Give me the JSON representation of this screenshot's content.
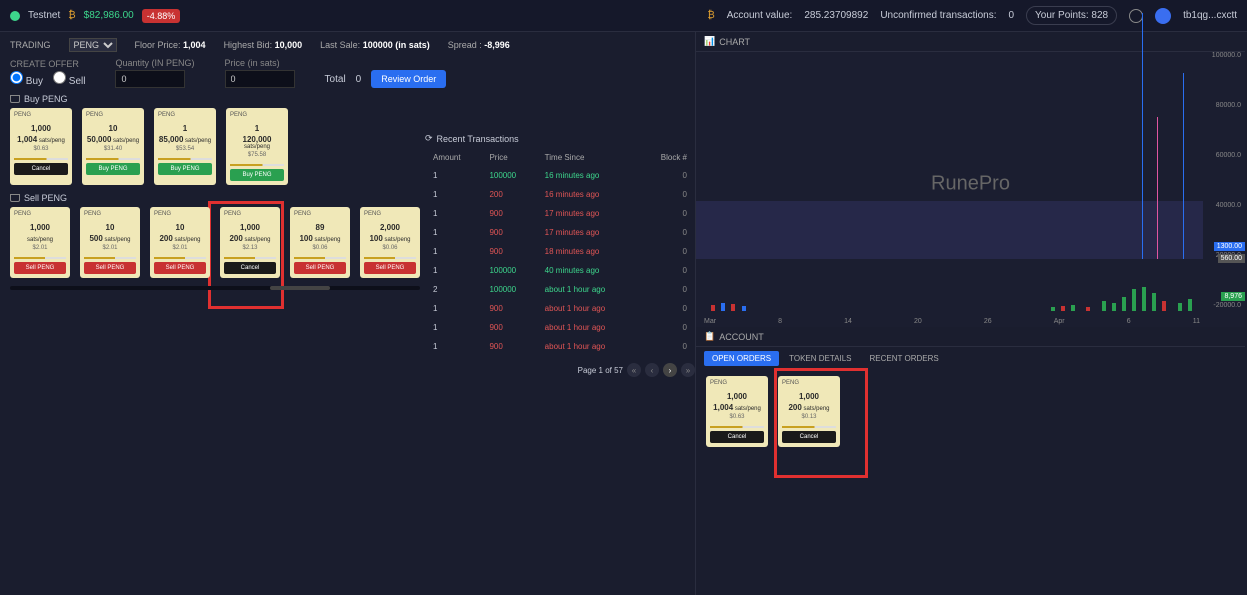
{
  "topbar": {
    "network": "Testnet",
    "balance_btc": "$82,986.00",
    "change_pct": "-4.88%",
    "account_value_label": "Account value:",
    "account_value": "285.23709892",
    "unconfirmed_label": "Unconfirmed transactions:",
    "unconfirmed": "0",
    "points_label": "Your Points:",
    "points": "828",
    "wallet": "tb1qg...cxctt"
  },
  "stats": {
    "trading_label": "TRADING",
    "token": "PENG",
    "floor_label": "Floor Price:",
    "floor": "1,004",
    "highbid_label": "Highest Bid:",
    "highbid": "10,000",
    "lastsale_label": "Last Sale:",
    "lastsale": "100000 (in sats)",
    "spread_label": "Spread :",
    "spread": "-8,996"
  },
  "offer": {
    "create_label": "CREATE OFFER",
    "qty_label": "Quantity",
    "qty_unit": "(IN PENG)",
    "price_label": "Price",
    "price_unit": "(in sats)",
    "buy": "Buy",
    "sell": "Sell",
    "qty_val": "0",
    "price_val": "0",
    "total_label": "Total",
    "total_val": "0",
    "review": "Review Order"
  },
  "buy_section": {
    "title": "Buy PENG"
  },
  "sell_section": {
    "title": "Sell PENG"
  },
  "buy_cards": [
    {
      "tkr": "PENG",
      "amt": "1,000",
      "rate": "1,004",
      "unit": "sats/peng",
      "usd": "$0.63",
      "btn": "Cancel",
      "cls": "btn-black"
    },
    {
      "tkr": "PENG",
      "amt": "10",
      "rate": "50,000",
      "unit": "sats/peng",
      "usd": "$31.40",
      "btn": "Buy PENG",
      "cls": "btn-green"
    },
    {
      "tkr": "PENG",
      "amt": "1",
      "rate": "85,000",
      "unit": "sats/peng",
      "usd": "$53.54",
      "btn": "Buy PENG",
      "cls": "btn-green"
    },
    {
      "tkr": "PENG",
      "amt": "1",
      "rate": "120,000",
      "unit": "sats/peng",
      "usd": "$75.58",
      "btn": "Buy PENG",
      "cls": "btn-green"
    }
  ],
  "sell_cards": [
    {
      "tkr": "PENG",
      "amt": "1,000",
      "rate": "",
      "unit": "sats/peng",
      "usd": "$2.01",
      "btn": "Sell PENG",
      "cls": "btn-red"
    },
    {
      "tkr": "PENG",
      "amt": "10",
      "rate": "500",
      "unit": "sats/peng",
      "usd": "$2.01",
      "btn": "Sell PENG",
      "cls": "btn-red"
    },
    {
      "tkr": "PENG",
      "amt": "10",
      "rate": "200",
      "unit": "sats/peng",
      "usd": "$2.01",
      "btn": "Sell PENG",
      "cls": "btn-red"
    },
    {
      "tkr": "PENG",
      "amt": "1,000",
      "rate": "200",
      "unit": "sats/peng",
      "usd": "$2.13",
      "btn": "Cancel",
      "cls": "btn-black"
    },
    {
      "tkr": "PENG",
      "amt": "89",
      "rate": "100",
      "unit": "sats/peng",
      "usd": "$0.06",
      "btn": "Sell PENG",
      "cls": "btn-red"
    },
    {
      "tkr": "PENG",
      "amt": "2,000",
      "rate": "100",
      "unit": "sats/peng",
      "usd": "$0.06",
      "btn": "Sell PENG",
      "cls": "btn-red"
    }
  ],
  "tx": {
    "title": "Recent Transactions",
    "cols": {
      "amount": "Amount",
      "price": "Price",
      "time": "Time Since",
      "block": "Block #"
    },
    "rows": [
      {
        "side": "buy",
        "a": "1",
        "p": "100000",
        "t": "16 minutes ago",
        "b": "0"
      },
      {
        "side": "sell",
        "a": "1",
        "p": "200",
        "t": "16 minutes ago",
        "b": "0"
      },
      {
        "side": "sell",
        "a": "1",
        "p": "900",
        "t": "17 minutes ago",
        "b": "0"
      },
      {
        "side": "sell",
        "a": "1",
        "p": "900",
        "t": "17 minutes ago",
        "b": "0"
      },
      {
        "side": "sell",
        "a": "1",
        "p": "900",
        "t": "18 minutes ago",
        "b": "0"
      },
      {
        "side": "buy",
        "a": "1",
        "p": "100000",
        "t": "40 minutes ago",
        "b": "0"
      },
      {
        "side": "buy",
        "a": "2",
        "p": "100000",
        "t": "about 1 hour ago",
        "b": "0"
      },
      {
        "side": "sell",
        "a": "1",
        "p": "900",
        "t": "about 1 hour ago",
        "b": "0"
      },
      {
        "side": "sell",
        "a": "1",
        "p": "900",
        "t": "about 1 hour ago",
        "b": "0"
      },
      {
        "side": "sell",
        "a": "1",
        "p": "900",
        "t": "about 1 hour ago",
        "b": "0"
      }
    ],
    "page_label": "Page 1 of 57"
  },
  "chart": {
    "title": "CHART",
    "watermark": "RunePro",
    "price_tag_blue": "1300.00",
    "price_tag_gray": "560.00",
    "price_tag_green": "8,976"
  },
  "chart_data": {
    "type": "bar",
    "ylabel": "",
    "ylim": [
      0,
      100000
    ],
    "y_ticks": [
      100000,
      80000,
      60000,
      40000,
      20000,
      -20000
    ],
    "x_ticks": [
      "Mar",
      "8",
      "14",
      "20",
      "26",
      "Apr",
      "6",
      "11"
    ],
    "volume_bars": [
      {
        "x_pct": 3,
        "h": 6,
        "color": "#c83232"
      },
      {
        "x_pct": 5,
        "h": 8,
        "color": "#2a6ef0"
      },
      {
        "x_pct": 7,
        "h": 7,
        "color": "#c83232"
      },
      {
        "x_pct": 9,
        "h": 5,
        "color": "#2a6ef0"
      },
      {
        "x_pct": 70,
        "h": 4,
        "color": "#2aa050"
      },
      {
        "x_pct": 72,
        "h": 5,
        "color": "#c83232"
      },
      {
        "x_pct": 74,
        "h": 6,
        "color": "#2aa050"
      },
      {
        "x_pct": 77,
        "h": 4,
        "color": "#c83232"
      },
      {
        "x_pct": 80,
        "h": 10,
        "color": "#2aa050"
      },
      {
        "x_pct": 82,
        "h": 8,
        "color": "#2aa050"
      },
      {
        "x_pct": 84,
        "h": 14,
        "color": "#2aa050"
      },
      {
        "x_pct": 86,
        "h": 22,
        "color": "#2aa050"
      },
      {
        "x_pct": 88,
        "h": 24,
        "color": "#2aa050"
      },
      {
        "x_pct": 90,
        "h": 18,
        "color": "#2aa050"
      },
      {
        "x_pct": 92,
        "h": 10,
        "color": "#c83232"
      },
      {
        "x_pct": 95,
        "h": 8,
        "color": "#2aa050"
      },
      {
        "x_pct": 97,
        "h": 12,
        "color": "#2aa050"
      }
    ],
    "spikes": [
      {
        "x_pct": 88,
        "h_pct": 95,
        "color": "#2a6ef0"
      },
      {
        "x_pct": 91,
        "h_pct": 55,
        "color": "#e055a0"
      },
      {
        "x_pct": 96,
        "h_pct": 72,
        "color": "#2a6ef0"
      }
    ]
  },
  "account": {
    "title": "ACCOUNT",
    "tabs": {
      "open": "OPEN ORDERS",
      "token": "TOKEN DETAILS",
      "recent": "RECENT ORDERS"
    },
    "cards": [
      {
        "tkr": "PENG",
        "amt": "1,000",
        "rate": "1,004",
        "unit": "sats/peng",
        "usd": "$0.63",
        "btn": "Cancel"
      },
      {
        "tkr": "PENG",
        "amt": "1,000",
        "rate": "200",
        "unit": "sats/peng",
        "usd": "$0.13",
        "btn": "Cancel"
      }
    ]
  }
}
